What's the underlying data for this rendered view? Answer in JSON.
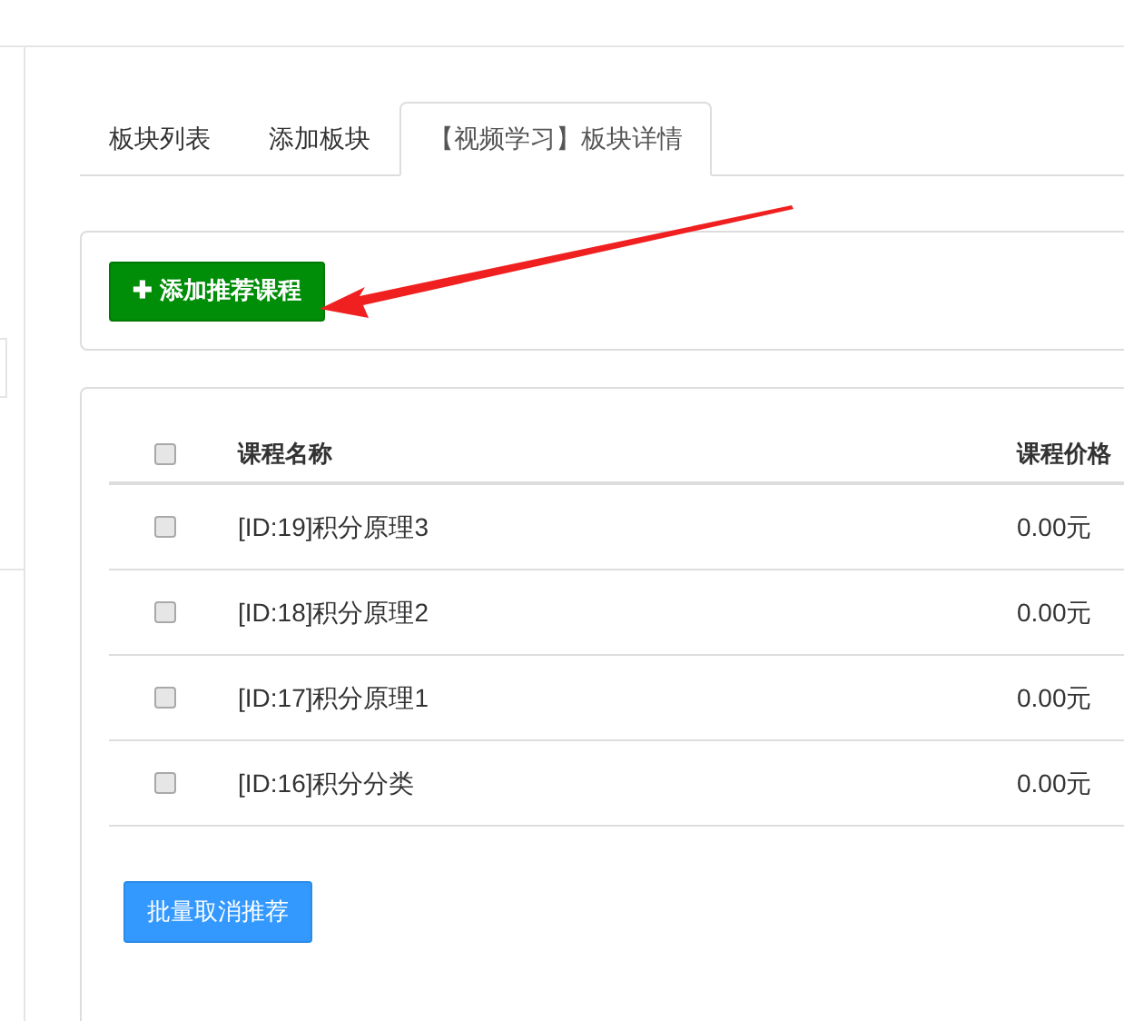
{
  "tabs": [
    {
      "label": "板块列表",
      "selected": false
    },
    {
      "label": "添加板块",
      "selected": false
    },
    {
      "label": "【视频学习】板块详情",
      "selected": true
    }
  ],
  "add_button": {
    "icon": "✚",
    "label": "添加推荐课程"
  },
  "table": {
    "select_all": {
      "checked": false
    },
    "columns": [
      "课程名称",
      "课程价格"
    ],
    "rows": [
      {
        "checked": false,
        "name": "[ID:19]积分原理3",
        "price": "0.00元"
      },
      {
        "checked": false,
        "name": "[ID:18]积分原理2",
        "price": "0.00元"
      },
      {
        "checked": false,
        "name": "[ID:17]积分原理1",
        "price": "0.00元"
      },
      {
        "checked": false,
        "name": "[ID:16]积分分类",
        "price": "0.00元"
      }
    ]
  },
  "batch_button": "批量取消推荐"
}
